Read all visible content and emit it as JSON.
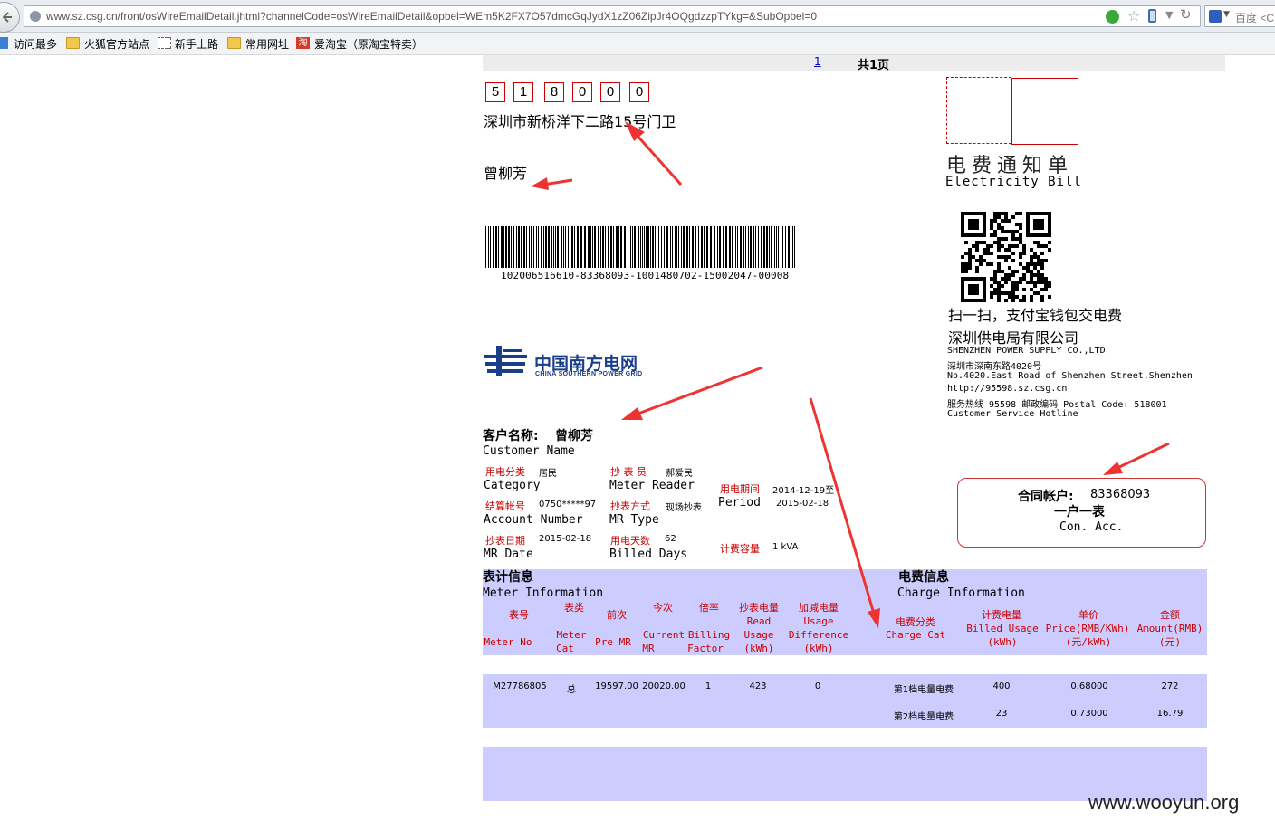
{
  "browser": {
    "url": "www.sz.csg.cn/front/osWireEmailDetail.jhtml?channelCode=osWireEmailDetail&opbel=WEm5K2FX7O57dmcGqJydX1zZ06ZipJr4OQgdzzpTYkg=&SubOpbel=0",
    "search_engine_label": "百度 <C",
    "bookmarks": [
      "访问最多",
      "火狐官方站点",
      "新手上路",
      "常用网址",
      "爱淘宝（原淘宝特卖）"
    ],
    "taobao_glyph": "淘"
  },
  "pager": {
    "page_link": "1",
    "total": "共1页"
  },
  "mail": {
    "zip_digits": [
      "5",
      "1",
      "8",
      "0",
      "0",
      "0"
    ],
    "address": "深圳市新桥洋下二路15号门卫",
    "recipient": "曾柳芳",
    "barcode_text": "102006516610-83368093-1001480702-15002047-00008"
  },
  "header": {
    "title_cn": "电费通知单",
    "title_en": "Electricity Bill",
    "qr_caption": "扫一扫，支付宝钱包交电费",
    "company_cn": "深圳供电局有限公司",
    "company_lines": [
      "SHENZHEN POWER SUPPLY CO.,LTD",
      "深圳市深南东路4020号",
      "No.4020.East Road of Shenzhen Street,Shenzhen",
      "http://95598.sz.csg.cn",
      "服务热线 95598 邮政编码 Postal Code: 518001",
      "Customer Service Hotline"
    ]
  },
  "logo": {
    "cn": "中国南方电网",
    "en": "CHINA SOUTHERN POWER GRID",
    "color": "#1b3e88"
  },
  "customer": {
    "name_label": "客户名称:",
    "name": "曾柳芳",
    "name_label_en": "Customer Name",
    "category_label": "用电分类",
    "category_value": "居民",
    "category_en": "Category",
    "reader_label": "抄 表 员",
    "reader_value": "郝爱民",
    "reader_en": "Meter Reader",
    "period_label": "用电期间",
    "period_start": "2014-12-19至",
    "period_en": "Period",
    "period_end": "2015-02-18",
    "account_label": "结算帐号",
    "account_value": "0750*****97",
    "account_en": "Account Number",
    "mrtype_label": "抄表方式",
    "mrtype_value": "现场抄表",
    "mrtype_en": "MR Type",
    "mrdate_label": "抄表日期",
    "mrdate_value": "2015-02-18",
    "mrdate_en": "MR Date",
    "days_label": "用电天数",
    "days_value": "62",
    "days_en": "Billed Days",
    "capacity_label": "计费容量",
    "capacity_value": "1 kVA"
  },
  "contract": {
    "label": "合同帐户:",
    "value": "83368093",
    "type": "一户一表",
    "label_en": "Con. Acc."
  },
  "meter_section": {
    "title_cn": "表计信息",
    "title_en": "Meter Information"
  },
  "charge_section": {
    "title_cn": "电费信息",
    "title_en": "Charge Information"
  },
  "columns": {
    "meter_no": {
      "cn": "表号",
      "en": "Meter No"
    },
    "meter_cat": {
      "cn": "表类",
      "en1": "Meter",
      "en2": "Cat"
    },
    "pre": {
      "cn": "前次",
      "en": "Pre MR"
    },
    "current": {
      "cn": "今次",
      "en1": "Current",
      "en2": "MR"
    },
    "factor": {
      "cn": "倍率",
      "en1": "Billing",
      "en2": "Factor"
    },
    "read_usage": {
      "cn": "抄表电量",
      "en1": "Read",
      "en2": "Usage",
      "en3": "(kWh)"
    },
    "difference": {
      "cn": "加减电量",
      "en1": "Usage",
      "en2": "Difference",
      "en3": "(kWh)"
    },
    "charge_cat": {
      "cn": "电费分类",
      "en": "Charge Cat"
    },
    "billed": {
      "cn": "计费电量",
      "en1": "Billed Usage",
      "en2": "(kWh)"
    },
    "price": {
      "cn": "单价",
      "en1": "Price(RMB/KWh)",
      "en2": "(元/kWh)"
    },
    "amount": {
      "cn": "金额",
      "en1": "Amount(RMB)",
      "en2": "(元)"
    }
  },
  "meter_row": {
    "meter_no": "M27786805",
    "cat": "总",
    "pre": "19597.00",
    "current": "20020.00",
    "factor": "1",
    "read_usage": "423",
    "difference": "0"
  },
  "charge_rows": [
    {
      "cat": "第1档电量电费",
      "billed": "400",
      "price": "0.68000",
      "amount": "272"
    },
    {
      "cat": "第2档电量电费",
      "billed": "23",
      "price": "0.73000",
      "amount": "16.79"
    }
  ],
  "watermark": "www.wooyun.org",
  "colors": {
    "label_red": "#cc0000",
    "table_bg": "#ccccff",
    "arrow_red": "#ee3333"
  }
}
